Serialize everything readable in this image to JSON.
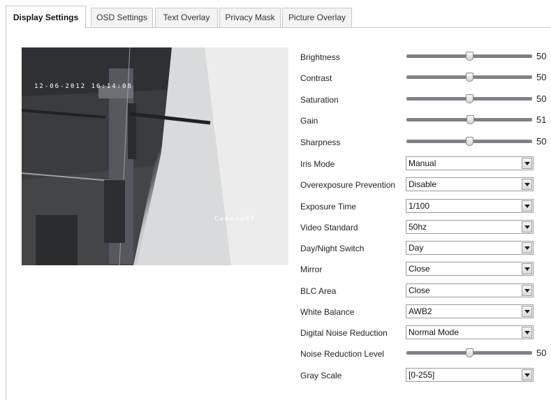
{
  "tabs": [
    {
      "label": "Display Settings",
      "active": true
    },
    {
      "label": "OSD Settings",
      "active": false
    },
    {
      "label": "Text Overlay",
      "active": false
    },
    {
      "label": "Privacy Mask",
      "active": false
    },
    {
      "label": "Picture Overlay",
      "active": false
    }
  ],
  "video": {
    "timestamp": "12-06-2012 16:14:08",
    "camera_name": "Camera05"
  },
  "sliders": {
    "brightness": {
      "label": "Brightness",
      "value": "50",
      "fraction": 0.5
    },
    "contrast": {
      "label": "Contrast",
      "value": "50",
      "fraction": 0.5
    },
    "saturation": {
      "label": "Saturation",
      "value": "50",
      "fraction": 0.5
    },
    "gain": {
      "label": "Gain",
      "value": "51",
      "fraction": 0.51
    },
    "sharpness": {
      "label": "Sharpness",
      "value": "50",
      "fraction": 0.5
    },
    "noise_reduction_level": {
      "label": "Noise Reduction Level",
      "value": "50",
      "fraction": 0.5
    }
  },
  "selects": {
    "iris_mode": {
      "label": "Iris Mode",
      "value": "Manual"
    },
    "overexposure_prevention": {
      "label": "Overexposure Prevention",
      "value": "Disable"
    },
    "exposure_time": {
      "label": "Exposure Time",
      "value": "1/100"
    },
    "video_standard": {
      "label": "Video Standard",
      "value": "50hz"
    },
    "day_night_switch": {
      "label": "Day/Night Switch",
      "value": "Day"
    },
    "mirror": {
      "label": "Mirror",
      "value": "Close"
    },
    "blc_area": {
      "label": "BLC Area",
      "value": "Close"
    },
    "white_balance": {
      "label": "White Balance",
      "value": "AWB2"
    },
    "digital_noise_reduction": {
      "label": "Digital Noise Reduction",
      "value": "Normal Mode"
    },
    "gray_scale": {
      "label": "Gray Scale",
      "value": "[0-255]"
    }
  }
}
